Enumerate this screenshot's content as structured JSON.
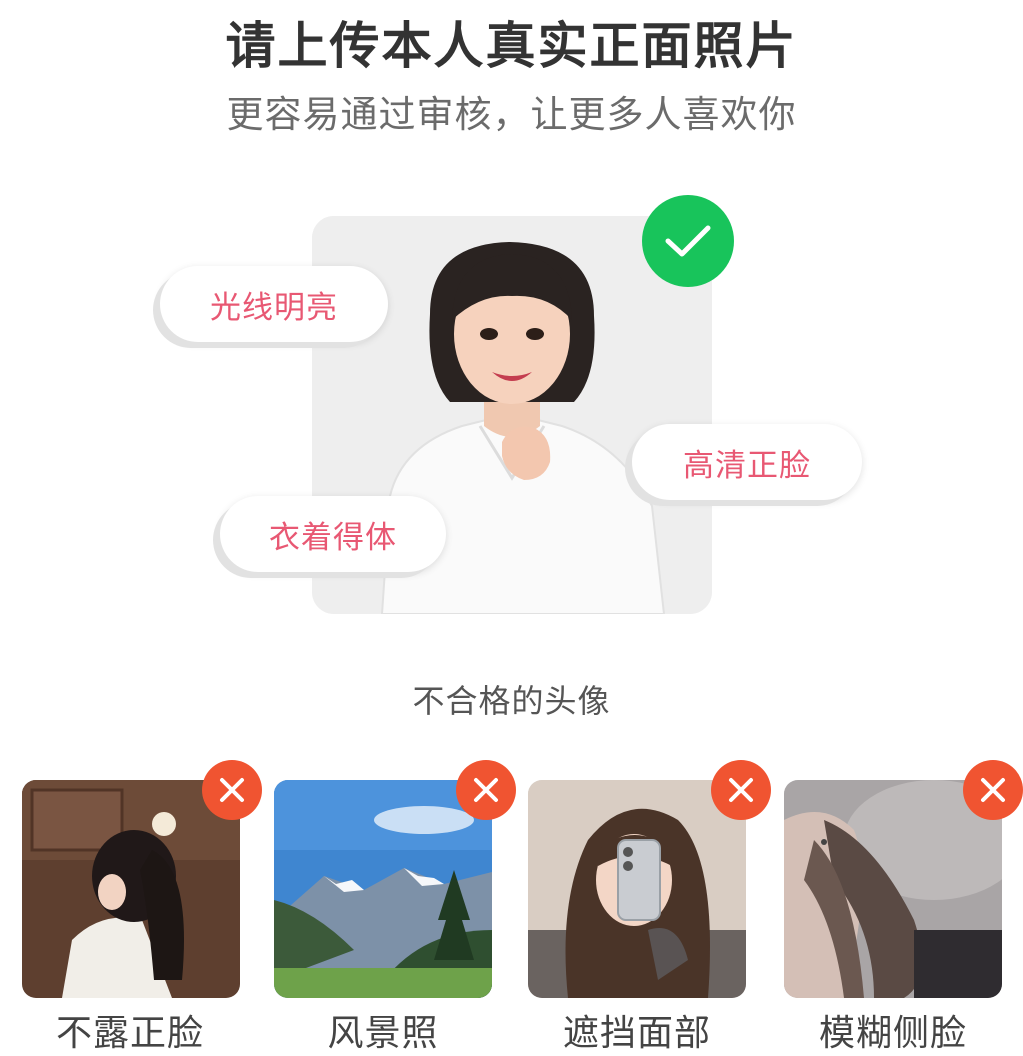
{
  "header": {
    "title": "请上传本人真实正面照片",
    "subtitle": "更容易通过审核，让更多人喜欢你"
  },
  "good_example": {
    "badges": {
      "lighting": "光线明亮",
      "clarity": "高清正脸",
      "attire": "衣着得体"
    },
    "status_icon": "check-icon"
  },
  "bad_examples": {
    "section_label": "不合格的头像",
    "items": [
      {
        "label": "不露正脸",
        "icon": "close-icon"
      },
      {
        "label": "风景照",
        "icon": "close-icon"
      },
      {
        "label": "遮挡面部",
        "icon": "close-icon"
      },
      {
        "label": "模糊侧脸",
        "icon": "close-icon"
      }
    ]
  },
  "colors": {
    "accent_pink": "#e85873",
    "check_green": "#18c45b",
    "reject_red": "#f05431"
  }
}
